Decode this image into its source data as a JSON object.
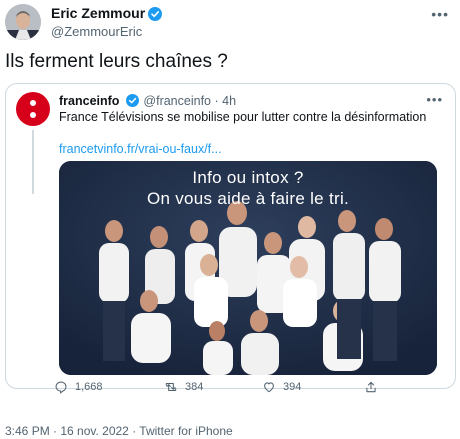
{
  "author": {
    "display_name": "Eric Zemmour",
    "handle": "@ZemmourEric"
  },
  "tweet": {
    "text": "Ils ferment leurs chaînes ?"
  },
  "quoted": {
    "name": "franceinfo",
    "handle": "@franceinfo",
    "time": "· 4h",
    "text": "France Télévisions se mobilise pour lutter contre la désinformation",
    "link": "francetvinfo.fr/vrai-ou-faux/f...",
    "image_title_line1": "Info ou intox ?",
    "image_title_line2": "On vous aide à faire le tri.",
    "replies": "1,668",
    "retweets": "384",
    "likes": "394"
  },
  "meta": {
    "timestamp": "3:46 PM · 16 nov. 2022 · Twitter for iPhone"
  },
  "colors": {
    "accent": "#1d9bf0",
    "brand_red": "#d7001a",
    "muted": "#536471"
  },
  "icons": [
    "verified-badge-icon",
    "more-icon",
    "reply-icon",
    "retweet-icon",
    "like-icon",
    "share-icon"
  ]
}
